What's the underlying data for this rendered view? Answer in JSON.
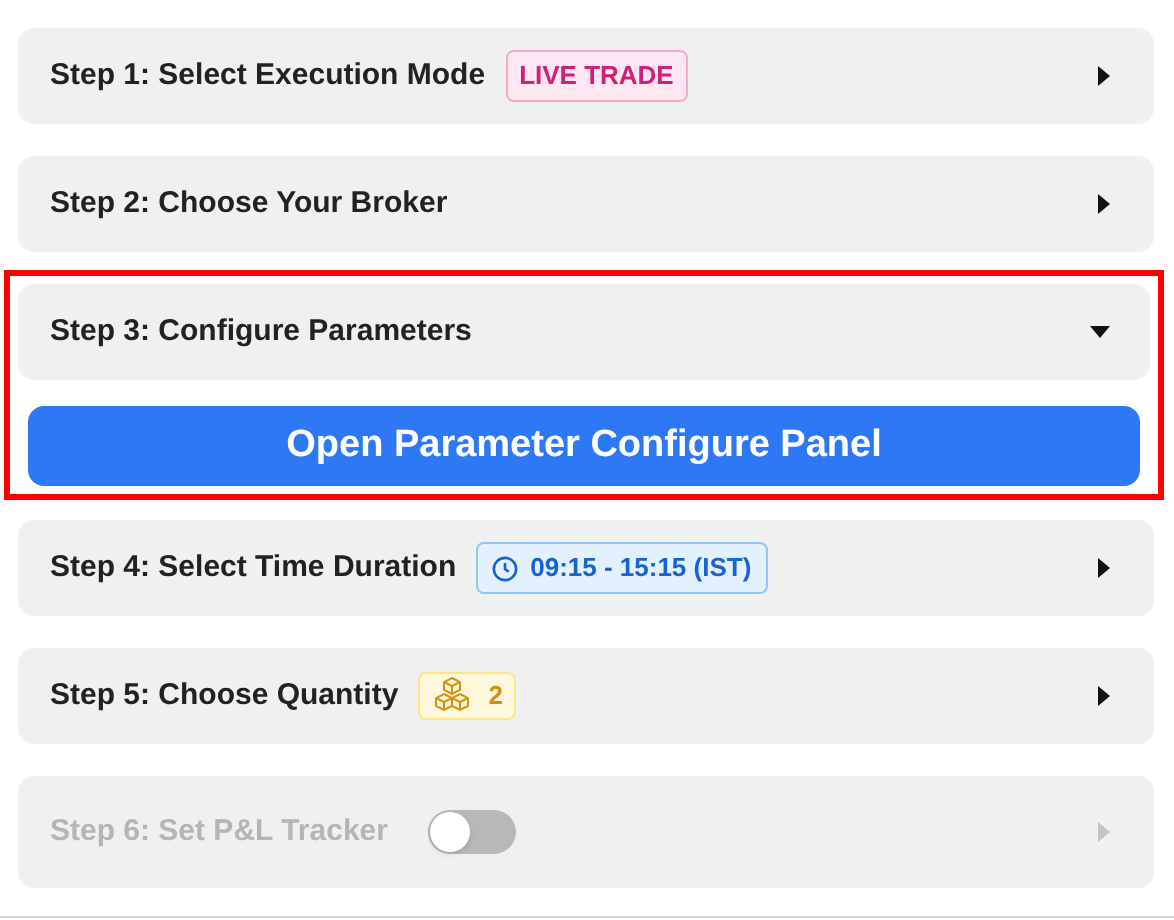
{
  "steps": [
    {
      "title": "Step 1: Select Execution Mode",
      "expanded": false,
      "disabled": false,
      "highlighted": false,
      "badge": {
        "kind": "mode",
        "text": "LIVE TRADE"
      }
    },
    {
      "title": "Step 2: Choose Your Broker",
      "expanded": false,
      "disabled": false,
      "highlighted": false
    },
    {
      "title": "Step 3: Configure Parameters",
      "expanded": true,
      "disabled": false,
      "highlighted": true,
      "action": "Open Parameter Configure Panel"
    },
    {
      "title": "Step 4: Select Time Duration",
      "expanded": false,
      "disabled": false,
      "highlighted": false,
      "badge": {
        "kind": "time",
        "text": "09:15 - 15:15 (IST)"
      }
    },
    {
      "title": "Step 5: Choose Quantity",
      "expanded": false,
      "disabled": false,
      "highlighted": false,
      "badge": {
        "kind": "quantity",
        "text": "2"
      }
    },
    {
      "title": "Step 6: Set P&L Tracker",
      "expanded": false,
      "disabled": true,
      "highlighted": false,
      "badge": {
        "kind": "toggle",
        "on": false
      }
    }
  ]
}
